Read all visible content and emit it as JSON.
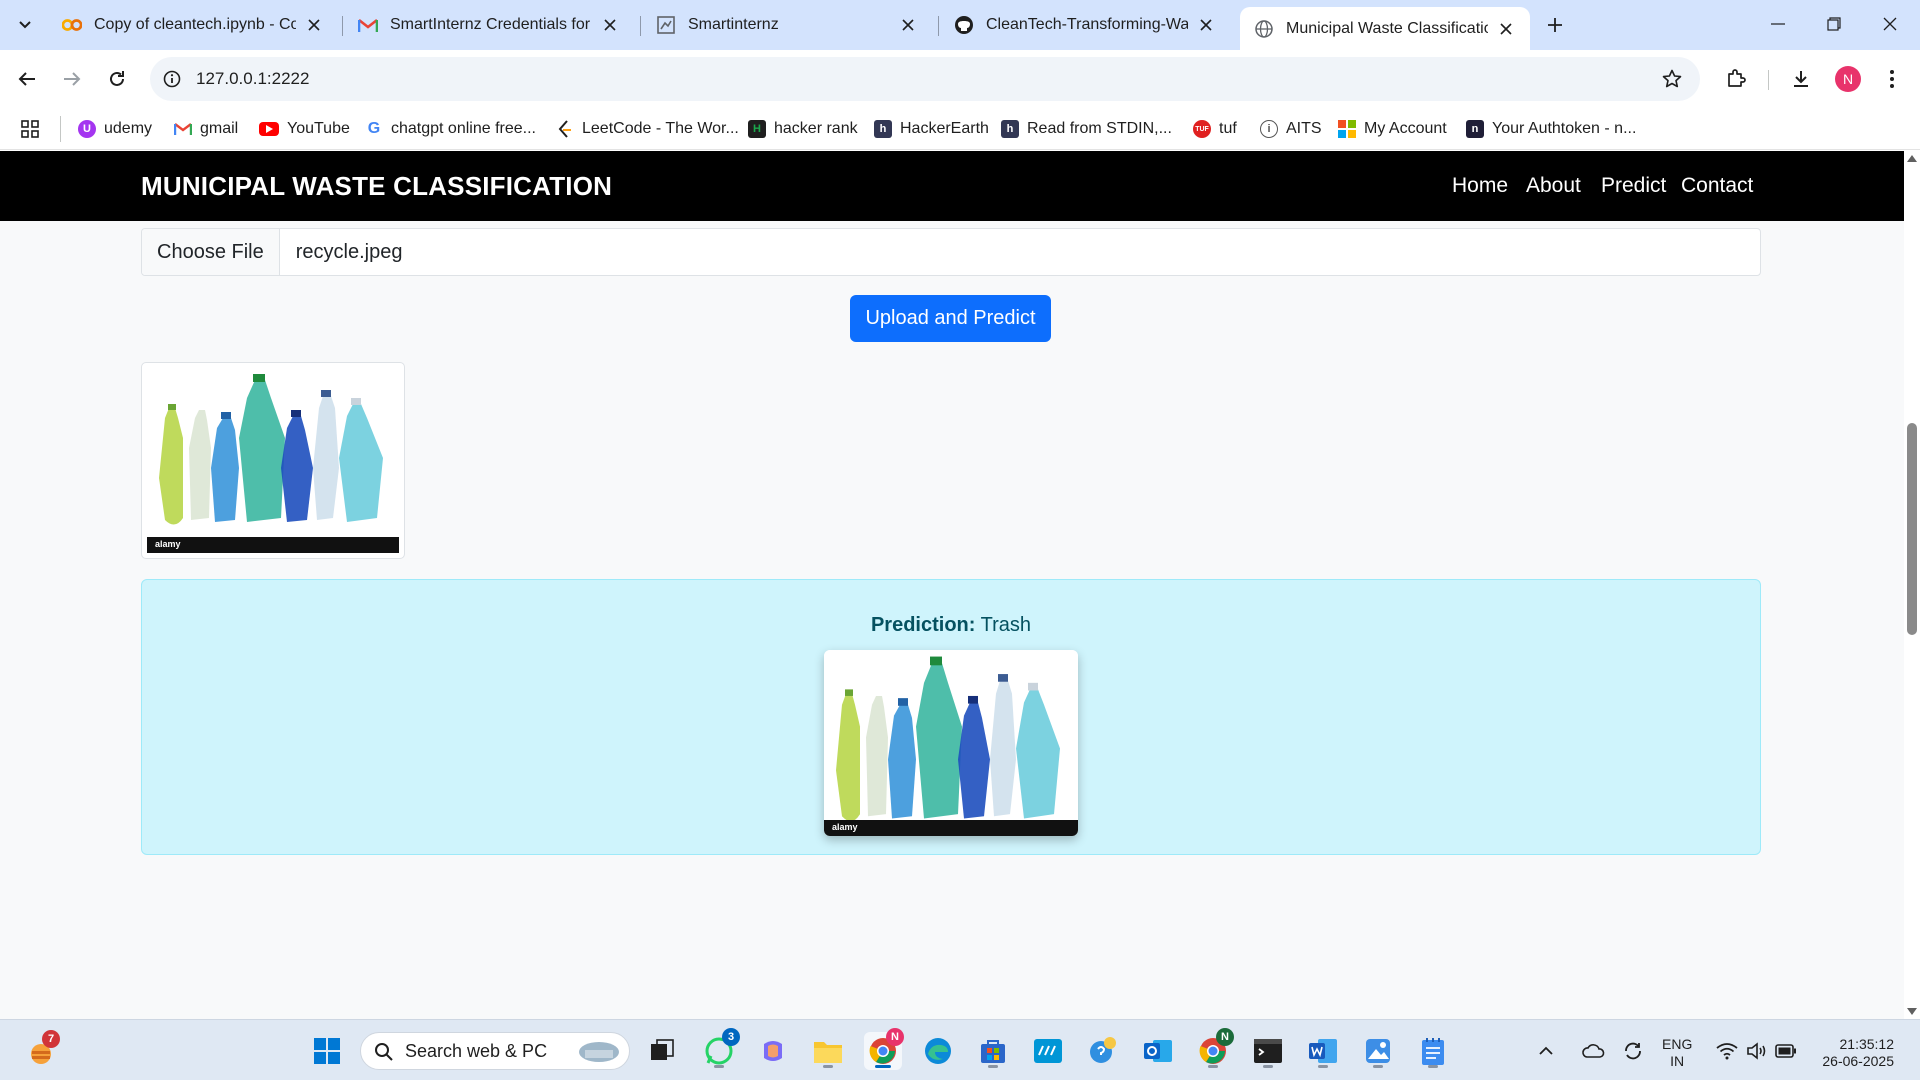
{
  "browser": {
    "tabs": [
      {
        "title": "Copy of cleantech.ipynb - Colab",
        "icon": "colab-icon"
      },
      {
        "title": "SmartInternz Credentials for Sh",
        "icon": "gmail-icon"
      },
      {
        "title": "Smartinternz",
        "icon": "smartinternz-icon"
      },
      {
        "title": "CleanTech-Transforming-Waste",
        "icon": "github-icon"
      },
      {
        "title": "Municipal Waste Classification",
        "icon": "globe-icon",
        "active": true
      }
    ],
    "url": "127.0.0.1:2222",
    "profile_initial": "N",
    "bookmarks": [
      {
        "label": "udemy",
        "icon": "udemy-icon",
        "color": "#a435f0"
      },
      {
        "label": "gmail",
        "icon": "gmail-icon",
        "color": "#ea4335"
      },
      {
        "label": "YouTube",
        "icon": "youtube-icon",
        "color": "#ff0000"
      },
      {
        "label": "chatgpt online free...",
        "icon": "google-icon",
        "color": "#4285f4"
      },
      {
        "label": "LeetCode - The Wor...",
        "icon": "leetcode-icon",
        "color": "#ffa116"
      },
      {
        "label": "hacker rank",
        "icon": "hackerrank-icon",
        "color": "#1ba94c"
      },
      {
        "label": "HackerEarth",
        "icon": "hackerearth-icon",
        "color": "#323754"
      },
      {
        "label": "Read from STDIN,...",
        "icon": "hackerearth-icon",
        "color": "#323754"
      },
      {
        "label": "tuf",
        "icon": "tuf-icon",
        "color": "#e02020"
      },
      {
        "label": "AITS",
        "icon": "aits-icon",
        "color": "#555555"
      },
      {
        "label": "My Account",
        "icon": "microsoft-icon",
        "color": "#f25022"
      },
      {
        "label": "Your Authtoken - n...",
        "icon": "ngrok-icon",
        "color": "#1f1e37"
      }
    ]
  },
  "site": {
    "brand": "MUNICIPAL WASTE CLASSIFICATION",
    "nav": [
      "Home",
      "About",
      "Predict",
      "Contact"
    ],
    "file_button": "Choose File",
    "file_name": "recycle.jpeg",
    "submit_label": "Upload and Predict",
    "prediction_label": "Prediction:",
    "prediction_value": "Trash",
    "watermark": "alamy"
  },
  "taskbar": {
    "notification_count": "7",
    "search_placeholder": "Search web & PC",
    "whatsapp_badge": "3",
    "language": "ENG",
    "region": "IN",
    "time": "21:35:12",
    "date": "26-06-2025"
  }
}
